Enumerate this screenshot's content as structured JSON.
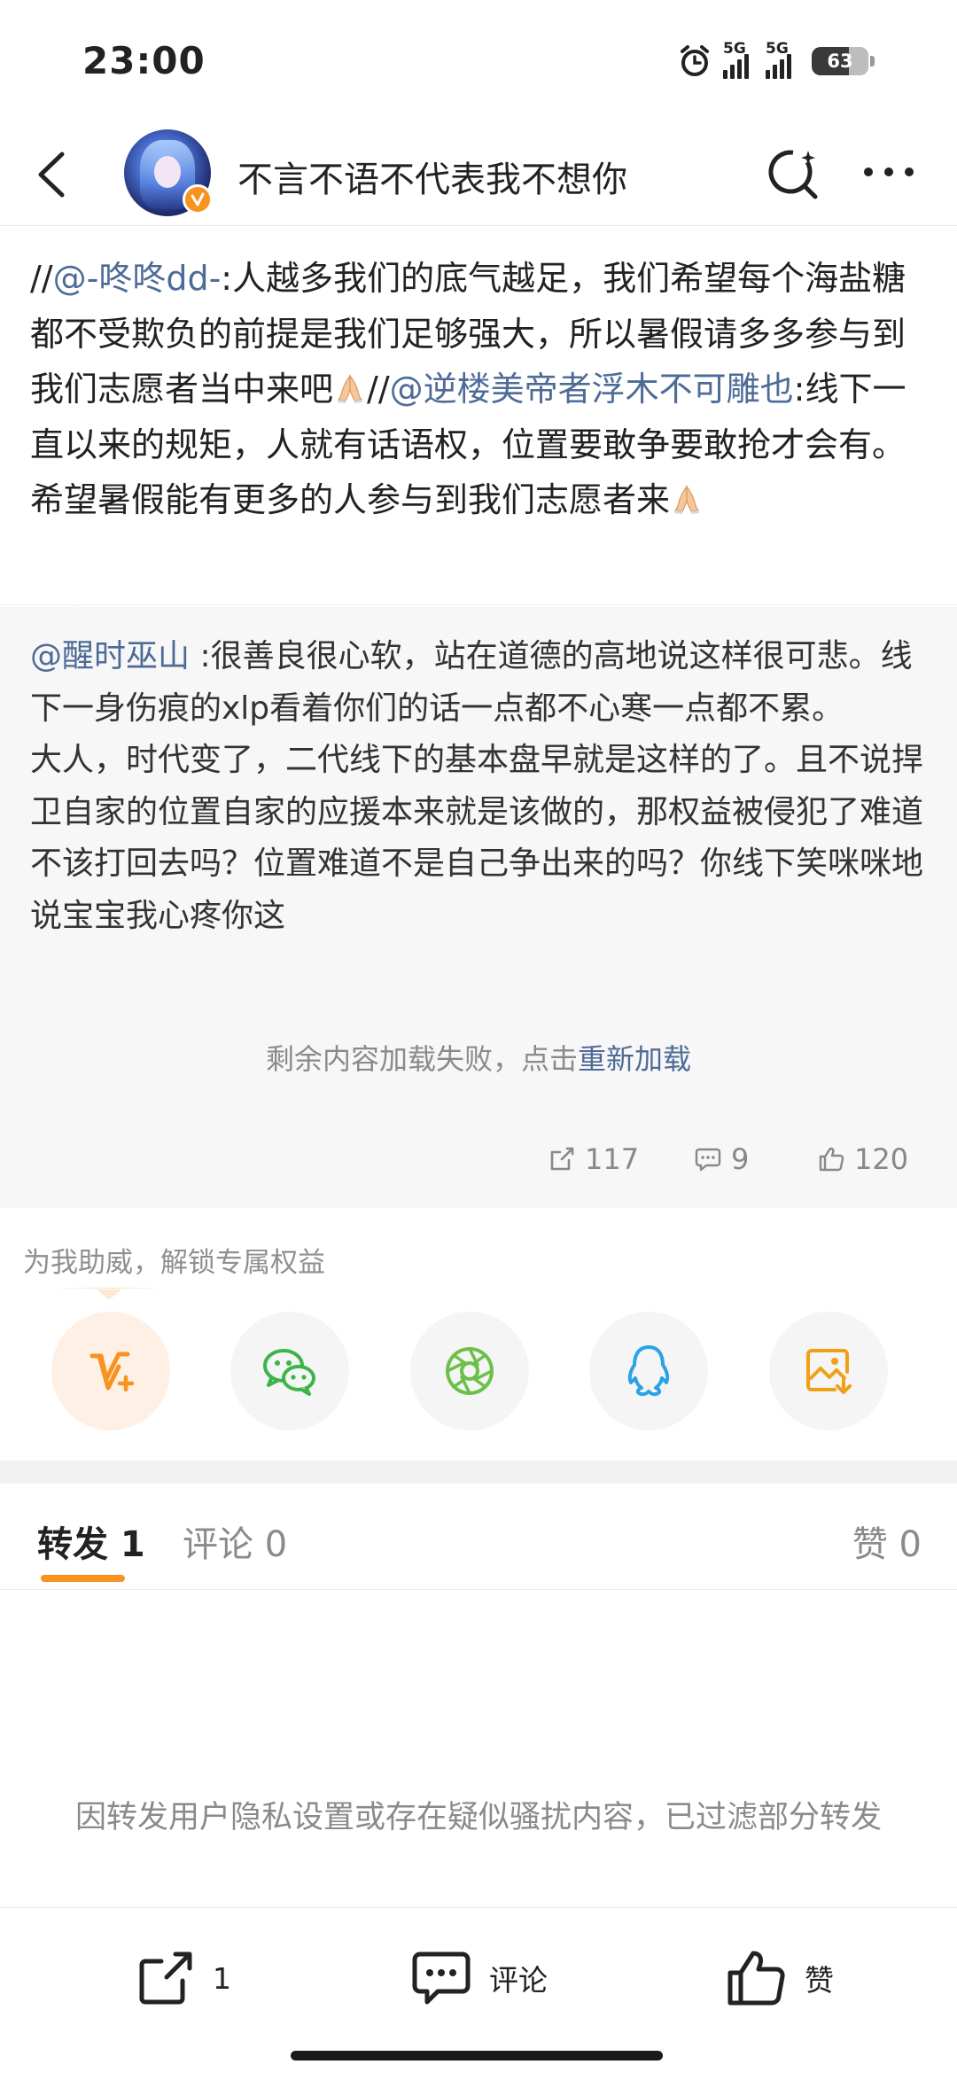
{
  "status_bar": {
    "time": "23:00",
    "network_1": "5G",
    "network_2": "5G",
    "battery": "63"
  },
  "header": {
    "title": "不言不语不代表我不想你"
  },
  "post": {
    "seg_1": "//",
    "mention_1": "@-咚咚dd-",
    "seg_2": ":人越多我们的底气越足，我们希望每个海盐糖都不受欺负的前提是我们足够强大，所以暑假请多多参与到我们志愿者当中来吧",
    "seg_3": "//",
    "mention_2": "@逆楼美帝者浮木不可雕也",
    "seg_4": ":线下一直以来的规矩，人就有话语权，位置要敢争要敢抢才会有。希望暑假能有更多的人参与到我们志愿者来"
  },
  "quoted": {
    "author": "@醒时巫山",
    "text": " :很善良很心软，站在道德的高地说这样很可悲。线下一身伤痕的xlp看着你们的话一点都不心寒一点都不累。\n大人，时代变了，二代线下的基本盘早就是这样的了。且不说捍卫自家的位置自家的应援本来就是该做的，那权益被侵犯了难道不该打回去吗？位置难道不是自己争出来的吗？你线下笑咪咪地说宝宝我心疼你这",
    "load_failed": "剩余内容加载失败，点击",
    "reload": "重新加载",
    "reposts": "117",
    "comments": "9",
    "likes": "120"
  },
  "share": {
    "hint": "为我助威，解锁专属权益"
  },
  "tabs": {
    "repost": "转发 1",
    "comment": "评论 0",
    "like": "赞 0"
  },
  "filter_note": "因转发用户隐私设置或存在疑似骚扰内容，已过滤部分转发",
  "toolbar": {
    "repost_count": "1",
    "comment_label": "评论",
    "like_label": "赞"
  }
}
